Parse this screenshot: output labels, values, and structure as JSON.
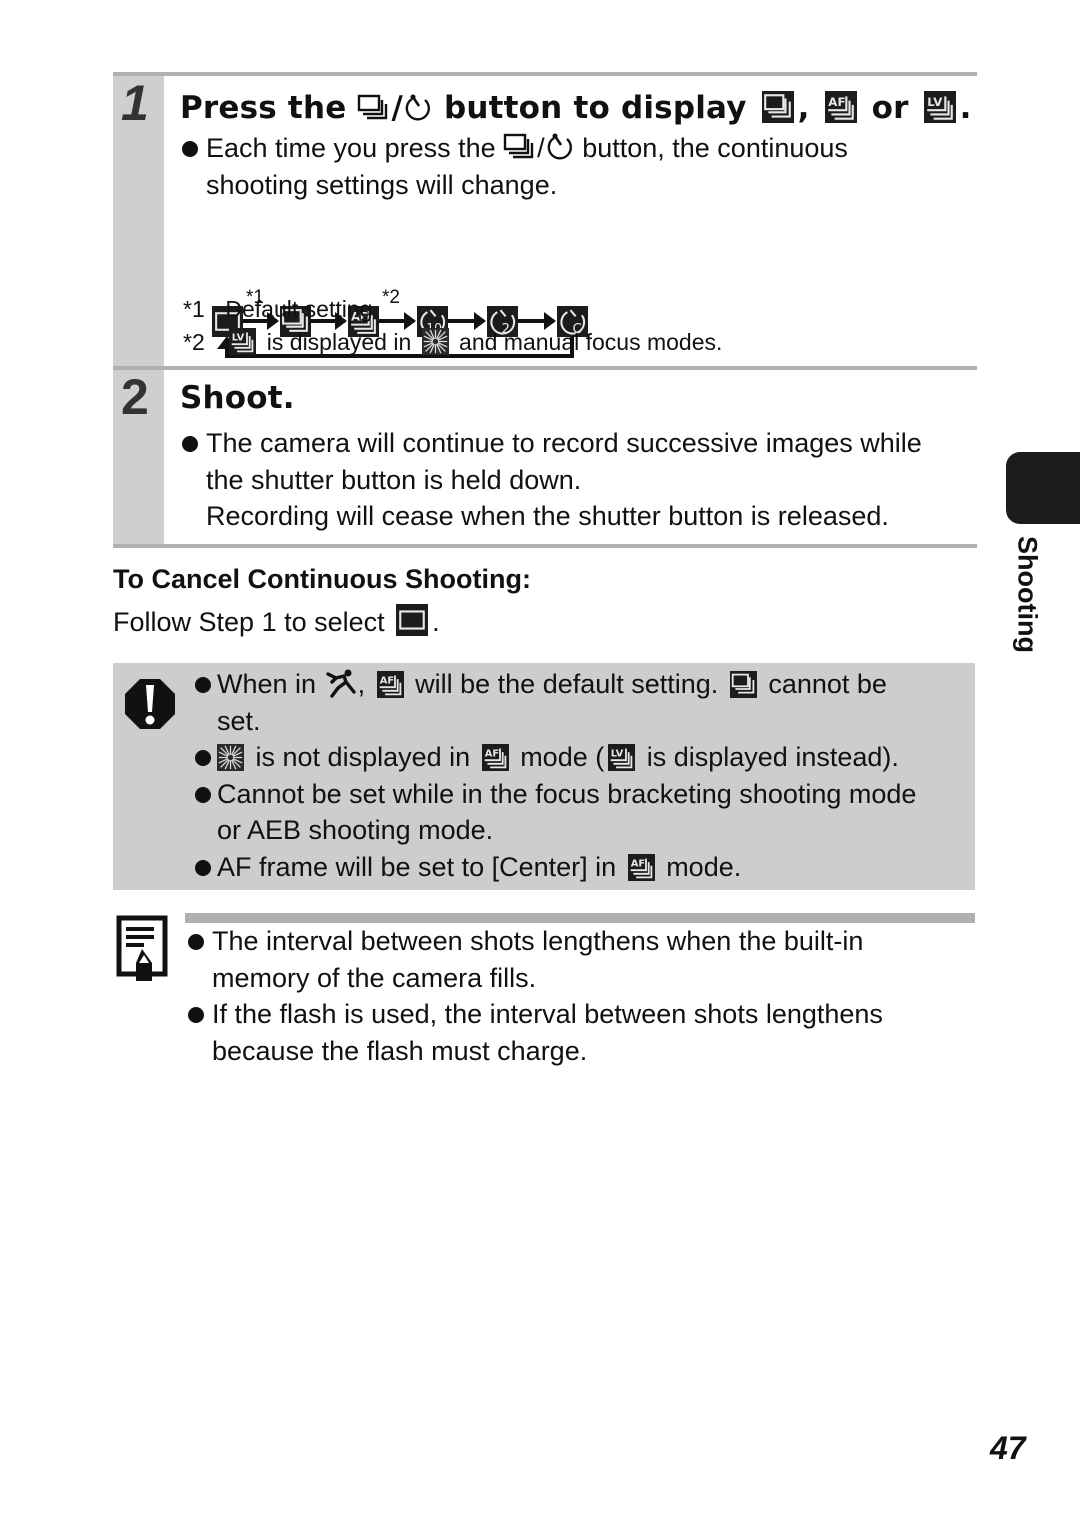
{
  "step1": {
    "number": "1",
    "title_parts": [
      "Press the",
      "/",
      "button to display",
      ",",
      "or",
      "."
    ],
    "bullet_parts": [
      "Each time you press the",
      "/",
      "button, the continuous",
      "shooting settings will change."
    ],
    "flow": {
      "nodes": [
        "single-shot",
        "continuous",
        "continuous-af",
        "self-timer-10s",
        "self-timer-2s",
        "custom-timer"
      ],
      "star1": "*1",
      "star2": "*2"
    },
    "footnotes": [
      {
        "mark": "*1",
        "text": "Default setting."
      },
      {
        "mark": "*2",
        "text_before": "is displayed in",
        "text_after": "and manual focus modes."
      }
    ]
  },
  "step2": {
    "number": "2",
    "title": "Shoot.",
    "bullet_line1": "The camera will continue to record successive images while",
    "bullet_line2": "the shutter button is held down.",
    "line3": "Recording will cease when the shutter button is released."
  },
  "cancel": {
    "heading": "To Cancel Continuous Shooting:",
    "text": "Follow Step 1 to select",
    "end": "."
  },
  "caution": {
    "items": [
      {
        "parts": [
          "When in",
          ",",
          "will be the default setting.",
          "cannot be"
        ],
        "cont": "set."
      },
      {
        "parts": [
          "is not displayed in",
          "mode (",
          "is displayed instead)."
        ]
      },
      {
        "line1": "Cannot be set while in the focus bracketing shooting mode",
        "line2": "or AEB shooting mode."
      },
      {
        "parts": [
          "AF frame will be set to [Center] in",
          "mode."
        ]
      }
    ]
  },
  "memo": {
    "items": [
      {
        "line1": "The interval between shots lengthens when the built-in",
        "line2": "memory of the camera fills."
      },
      {
        "line1": "If the flash is used, the interval between shots lengthens",
        "line2": "because the flash must charge."
      }
    ]
  },
  "side_tab": {
    "label": "Shooting"
  },
  "page_number": "47",
  "colors": {
    "step_panel": "#cfcfcf",
    "rule": "#b0b0b0",
    "caution_bg": "#cdcdcd",
    "icon_bg": "#1c1c1c"
  }
}
